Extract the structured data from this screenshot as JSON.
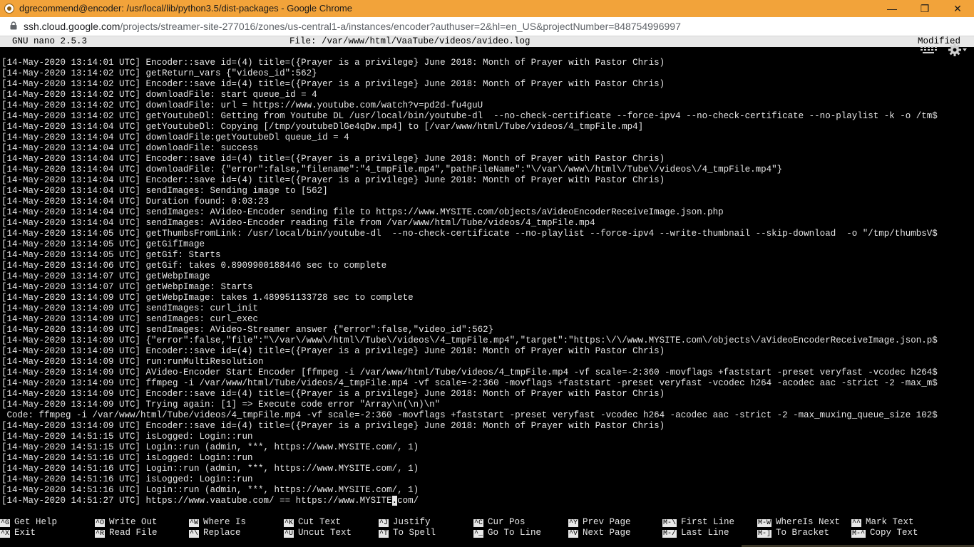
{
  "window": {
    "title": "dgrecommend@encoder: /usr/local/lib/python3.5/dist-packages - Google Chrome",
    "minimize": "—",
    "restore": "❐",
    "close": "✕"
  },
  "address": {
    "host": "ssh.cloud.google.com",
    "path": "/projects/streamer-site-277016/zones/us-central1-a/instances/encoder?authuser=2&hl=en_US&projectNumber=848754996997"
  },
  "nano": {
    "version": "GNU nano 2.5.3",
    "file": "File: /var/www/html/VaaTube/videos/avideo.log",
    "status": "Modified"
  },
  "log_lines": [
    "[14-May-2020 13:14:01 UTC] Encoder::save id=(4) title=({Prayer is a privilege} June 2018: Month of Prayer with Pastor Chris)",
    "[14-May-2020 13:14:02 UTC] getReturn_vars {\"videos_id\":562}",
    "[14-May-2020 13:14:02 UTC] Encoder::save id=(4) title=({Prayer is a privilege} June 2018: Month of Prayer with Pastor Chris)",
    "[14-May-2020 13:14:02 UTC] downloadFile: start queue_id = 4",
    "[14-May-2020 13:14:02 UTC] downloadFile: url = https://www.youtube.com/watch?v=pd2d-fu4guU",
    "[14-May-2020 13:14:02 UTC] getYoutubeDl: Getting from Youtube DL /usr/local/bin/youtube-dl  --no-check-certificate --force-ipv4 --no-check-certificate --no-playlist -k -o /tm$",
    "[14-May-2020 13:14:04 UTC] getYoutubeDl: Copying [/tmp/youtubeDlGe4qDw.mp4] to [/var/www/html/Tube/videos/4_tmpFile.mp4]",
    "[14-May-2020 13:14:04 UTC] downloadFile:getYoutubeDl queue_id = 4",
    "[14-May-2020 13:14:04 UTC] downloadFile: success",
    "[14-May-2020 13:14:04 UTC] Encoder::save id=(4) title=({Prayer is a privilege} June 2018: Month of Prayer with Pastor Chris)",
    "[14-May-2020 13:14:04 UTC] downloadFile: {\"error\":false,\"filename\":\"4_tmpFile.mp4\",\"pathFileName\":\"\\/var\\/www\\/html\\/Tube\\/videos\\/4_tmpFile.mp4\"}",
    "[14-May-2020 13:14:04 UTC] Encoder::save id=(4) title=({Prayer is a privilege} June 2018: Month of Prayer with Pastor Chris)",
    "[14-May-2020 13:14:04 UTC] sendImages: Sending image to [562]",
    "[14-May-2020 13:14:04 UTC] Duration found: 0:03:23",
    "[14-May-2020 13:14:04 UTC] sendImages: AVideo-Encoder sending file to https://www.MYSITE.com/objects/aVideoEncoderReceiveImage.json.php",
    "[14-May-2020 13:14:04 UTC] sendImages: AVideo-Encoder reading file from /var/www/html/Tube/videos/4_tmpFile.mp4",
    "[14-May-2020 13:14:05 UTC] getThumbsFromLink: /usr/local/bin/youtube-dl  --no-check-certificate --no-playlist --force-ipv4 --write-thumbnail --skip-download  -o \"/tmp/thumbsV$",
    "[14-May-2020 13:14:05 UTC] getGifImage",
    "[14-May-2020 13:14:05 UTC] getGif: Starts",
    "[14-May-2020 13:14:06 UTC] getGif: takes 0.8909900188446 sec to complete",
    "[14-May-2020 13:14:07 UTC] getWebpImage",
    "[14-May-2020 13:14:07 UTC] getWebpImage: Starts",
    "[14-May-2020 13:14:09 UTC] getWebpImage: takes 1.489951133728 sec to complete",
    "[14-May-2020 13:14:09 UTC] sendImages: curl_init",
    "[14-May-2020 13:14:09 UTC] sendImages: curl_exec",
    "[14-May-2020 13:14:09 UTC] sendImages: AVideo-Streamer answer {\"error\":false,\"video_id\":562}",
    "[14-May-2020 13:14:09 UTC] {\"error\":false,\"file\":\"\\/var\\/www\\/html\\/Tube\\/videos\\/4_tmpFile.mp4\",\"target\":\"https:\\/\\/www.MYSITE.com\\/objects\\/aVideoEncoderReceiveImage.json.p$",
    "[14-May-2020 13:14:09 UTC] Encoder::save id=(4) title=({Prayer is a privilege} June 2018: Month of Prayer with Pastor Chris)",
    "[14-May-2020 13:14:09 UTC] run:runMultiResolution",
    "[14-May-2020 13:14:09 UTC] AVideo-Encoder Start Encoder [ffmpeg -i /var/www/html/Tube/videos/4_tmpFile.mp4 -vf scale=-2:360 -movflags +faststart -preset veryfast -vcodec h264$",
    "[14-May-2020 13:14:09 UTC] ffmpeg -i /var/www/html/Tube/videos/4_tmpFile.mp4 -vf scale=-2:360 -movflags +faststart -preset veryfast -vcodec h264 -acodec aac -strict -2 -max_m$",
    "[14-May-2020 13:14:09 UTC] Encoder::save id=(4) title=({Prayer is a privilege} June 2018: Month of Prayer with Pastor Chris)",
    "[14-May-2020 13:14:09 UTC] Trying again: [1] => Execute code error \"Array\\n(\\n)\\n\"",
    " Code: ffmpeg -i /var/www/html/Tube/videos/4_tmpFile.mp4 -vf scale=-2:360 -movflags +faststart -preset veryfast -vcodec h264 -acodec aac -strict -2 -max_muxing_queue_size 102$",
    "[14-May-2020 13:14:09 UTC] Encoder::save id=(4) title=({Prayer is a privilege} June 2018: Month of Prayer with Pastor Chris)",
    "[14-May-2020 14:51:15 UTC] isLogged: Login::run",
    "[14-May-2020 14:51:15 UTC] Login::run (admin, ***, https://www.MYSITE.com/, 1)",
    "[14-May-2020 14:51:16 UTC] isLogged: Login::run",
    "[14-May-2020 14:51:16 UTC] Login::run (admin, ***, https://www.MYSITE.com/, 1)",
    "[14-May-2020 14:51:16 UTC] isLogged: Login::run",
    "[14-May-2020 14:51:16 UTC] Login::run (admin, ***, https://www.MYSITE.com/, 1)"
  ],
  "last_line": {
    "before": "[14-May-2020 14:51:27 UTC] https://www.vaatube.com/ == https://www.MYSITE",
    "cursor": ".",
    "after": "com/"
  },
  "shortcuts_row1": [
    {
      "key": "^G",
      "label": "Get Help"
    },
    {
      "key": "^O",
      "label": "Write Out"
    },
    {
      "key": "^W",
      "label": "Where Is"
    },
    {
      "key": "^K",
      "label": "Cut Text"
    },
    {
      "key": "^J",
      "label": "Justify"
    },
    {
      "key": "^C",
      "label": "Cur Pos"
    },
    {
      "key": "^Y",
      "label": "Prev Page"
    },
    {
      "key": "M-\\",
      "label": "First Line"
    },
    {
      "key": "M-W",
      "label": "WhereIs Next"
    },
    {
      "key": "^^",
      "label": "Mark Text"
    }
  ],
  "shortcuts_row2": [
    {
      "key": "^X",
      "label": "Exit"
    },
    {
      "key": "^R",
      "label": "Read File"
    },
    {
      "key": "^\\",
      "label": "Replace"
    },
    {
      "key": "^U",
      "label": "Uncut Text"
    },
    {
      "key": "^T",
      "label": "To Spell"
    },
    {
      "key": "^_",
      "label": "Go To Line"
    },
    {
      "key": "^V",
      "label": "Next Page"
    },
    {
      "key": "M-/",
      "label": "Last Line"
    },
    {
      "key": "M-]",
      "label": "To Bracket"
    },
    {
      "key": "M-^",
      "label": "Copy Text"
    }
  ],
  "icons": {
    "keyboard": "keyboard-icon",
    "settings": "gear-icon",
    "lock": "lock-icon"
  }
}
